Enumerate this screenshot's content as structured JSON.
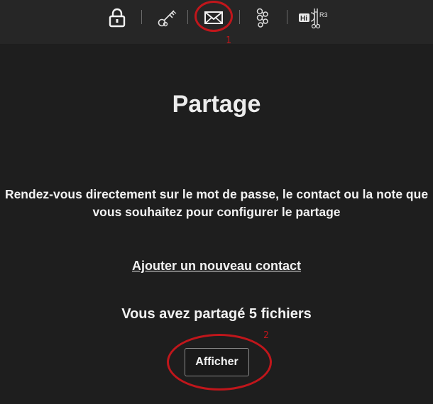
{
  "toolbar": {
    "icons": [
      {
        "name": "lock-icon"
      },
      {
        "name": "key-icon"
      },
      {
        "name": "mail-icon"
      },
      {
        "name": "share-graph-icon"
      },
      {
        "name": "hi-r3-icon",
        "label_hi": "Hi",
        "label_r3": "R3"
      }
    ]
  },
  "annotations": {
    "marker_1": "1",
    "marker_2": "2",
    "color": "#c0161b"
  },
  "main": {
    "title": "Partage",
    "description": "Rendez-vous directement sur le mot de passe, le contact ou la note que vous souhaitez pour configurer le partage",
    "add_contact_link": "Ajouter un nouveau contact",
    "shared_count_text": "Vous avez partagé 5 fichiers",
    "show_button": "Afficher"
  }
}
